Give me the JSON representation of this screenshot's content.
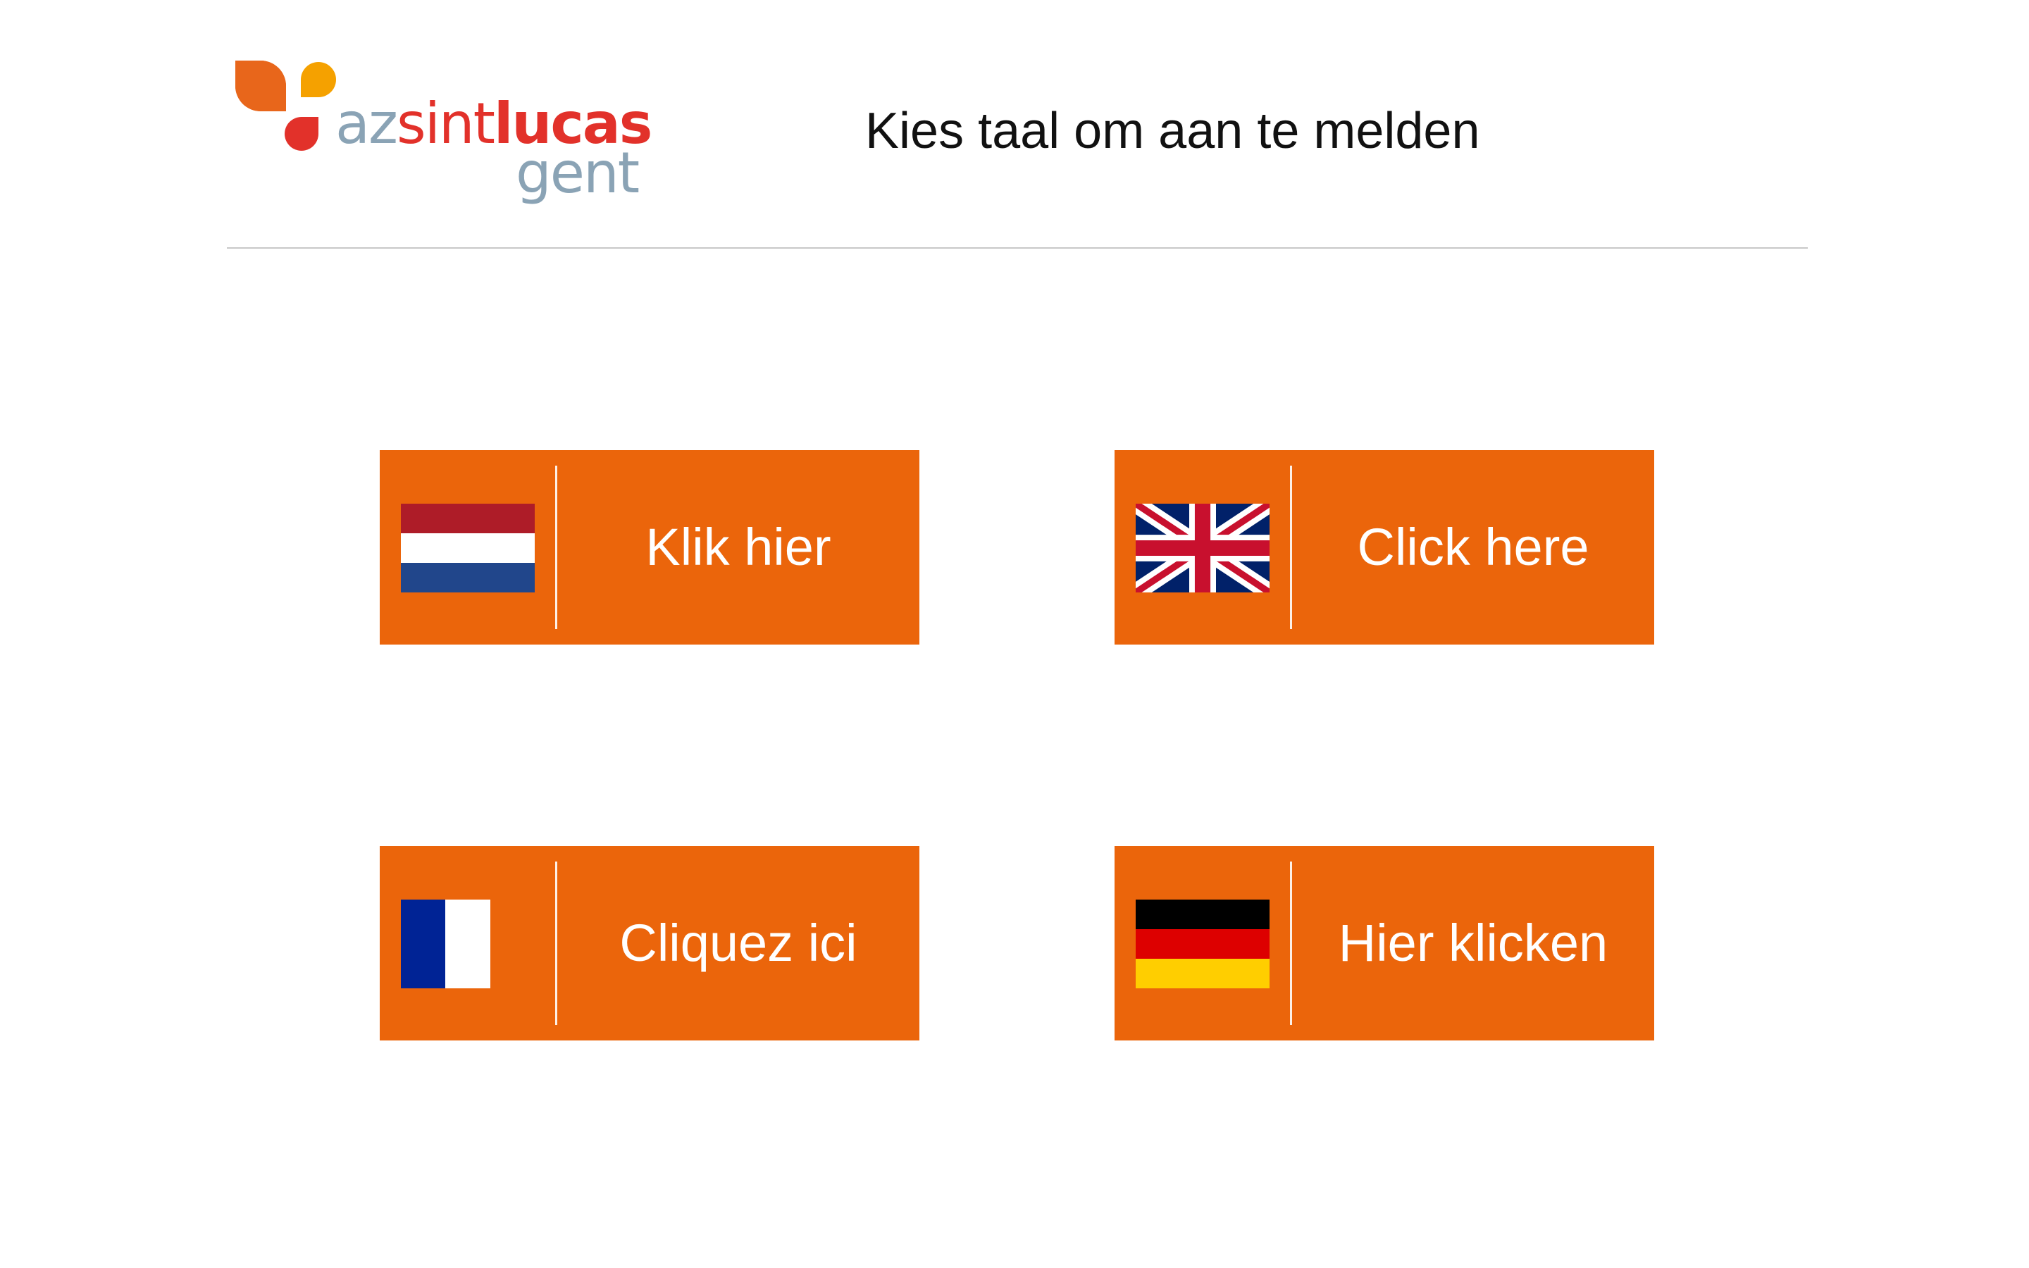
{
  "header": {
    "logo": {
      "name": "az sint lucas gent logo",
      "text_az": "az",
      "text_sint": "sint",
      "text_lucas": "lucas",
      "text_gent": "gent",
      "colors": {
        "orange": "#e8661b",
        "yellow": "#f5a100",
        "red": "#e2312a",
        "grey": "#8aa3b5"
      }
    },
    "title": "Kies taal om aan te melden"
  },
  "languages": [
    {
      "id": "nl",
      "label": "Klik hier",
      "flag": "netherlands-flag-icon",
      "colors": [
        "#ae1c28",
        "#ffffff",
        "#21468b"
      ]
    },
    {
      "id": "en",
      "label": "Click here",
      "flag": "uk-flag-icon",
      "colors": [
        "#012169",
        "#ffffff",
        "#c8102e"
      ]
    },
    {
      "id": "fr",
      "label": "Cliquez ici",
      "flag": "france-flag-icon",
      "colors": [
        "#002395",
        "#ffffff",
        "#ed2939"
      ]
    },
    {
      "id": "de",
      "label": "Hier klicken",
      "flag": "germany-flag-icon",
      "colors": [
        "#000000",
        "#dd0000",
        "#ffce00"
      ]
    }
  ],
  "theme": {
    "button_color": "#eb650b",
    "button_text_color": "#ffffff",
    "divider_color": "#c8c8c8"
  }
}
